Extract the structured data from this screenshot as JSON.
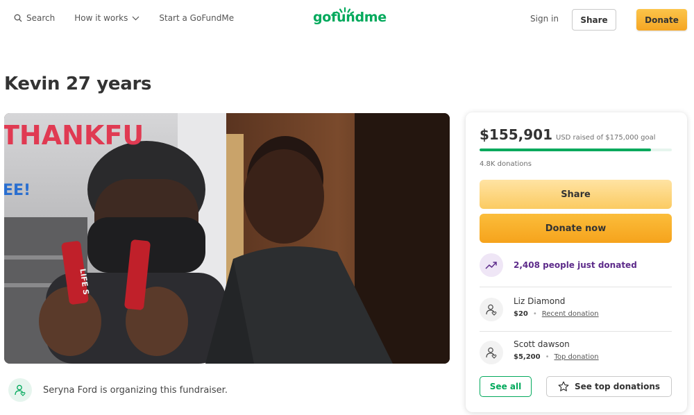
{
  "header": {
    "search_label": "Search",
    "how_it_works_label": "How it works",
    "start_label": "Start a GoFundMe",
    "logo_text": "gofundme",
    "sign_in_label": "Sign in",
    "share_label": "Share",
    "donate_label": "Donate"
  },
  "page_title": "Kevin 27 years",
  "photo": {
    "overlay_text": "THANKFU",
    "overlay_text_small": "EE!",
    "candy_label": "LIFE S"
  },
  "organizer": {
    "text": "Seryna Ford is organizing this fundraiser."
  },
  "card": {
    "raised_amount": "$155,901",
    "raised_text": "USD raised of $175,000 goal",
    "progress_fraction": 0.8909,
    "donation_count": "4.8K donations",
    "share_label": "Share",
    "donate_label": "Donate now",
    "trend_text": "2,408 people just donated",
    "donors": [
      {
        "name": "Liz Diamond",
        "amount": "$20",
        "tag": "Recent donation"
      },
      {
        "name": "Scott dawson",
        "amount": "$5,200",
        "tag": "Top donation"
      }
    ],
    "see_all_label": "See all",
    "see_top_label": "See top donations"
  },
  "colors": {
    "brand_green": "#02a95c",
    "donate_orange": "#f6a31c",
    "trend_purple": "#5d2b8a"
  },
  "icons": [
    "search-icon",
    "chevron-down-icon",
    "logo-sun-icon",
    "user-heart-icon",
    "trend-up-icon",
    "star-icon"
  ]
}
